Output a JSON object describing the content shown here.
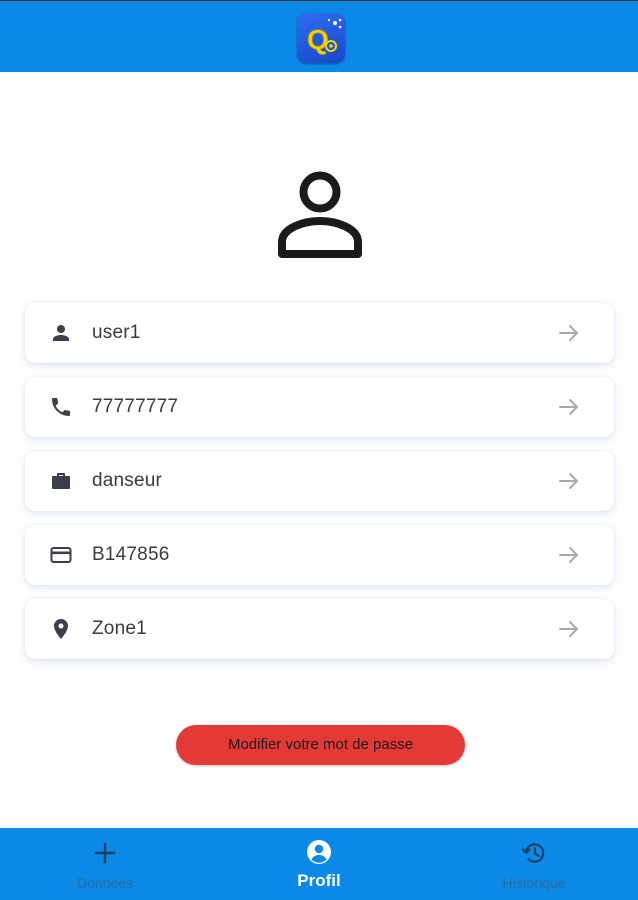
{
  "header": {
    "logo_icon": "app-logo-q-icon",
    "background": "#0a8ae6"
  },
  "profile": {
    "avatar_icon": "person-outline-icon",
    "fields": [
      {
        "icon": "person-icon",
        "value": "user1"
      },
      {
        "icon": "phone-icon",
        "value": "77777777"
      },
      {
        "icon": "briefcase-icon",
        "value": "danseur"
      },
      {
        "icon": "credit-card-icon",
        "value": "B147856"
      },
      {
        "icon": "location-pin-icon",
        "value": "Zone1"
      }
    ]
  },
  "actions": {
    "change_password_label": "Modifier votre mot de passe",
    "button_color": "#e53935"
  },
  "bottom_nav": {
    "items": [
      {
        "icon": "plus-icon",
        "label": "Données",
        "active": false
      },
      {
        "icon": "account-circle-icon",
        "label": "Profil",
        "active": true
      },
      {
        "icon": "history-icon",
        "label": "Historique",
        "active": false
      }
    ]
  }
}
